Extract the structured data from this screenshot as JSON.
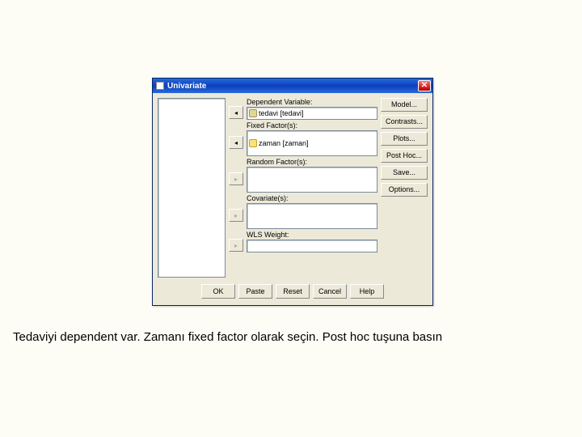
{
  "window": {
    "title": "Univariate"
  },
  "fields": {
    "dependent": {
      "label": "Dependent Variable:",
      "value": "tedavi [tedavi]"
    },
    "fixed": {
      "label": "Fixed Factor(s):",
      "value": "zaman [zaman]"
    },
    "random": {
      "label": "Random Factor(s):",
      "value": ""
    },
    "covariate": {
      "label": "Covariate(s):",
      "value": ""
    },
    "wls": {
      "label": "WLS Weight:",
      "value": ""
    }
  },
  "arrows": {
    "left": "◂",
    "right": "▸"
  },
  "sideButtons": {
    "model": "Model...",
    "contrasts": "Contrasts...",
    "plots": "Plots...",
    "posthoc": "Post Hoc...",
    "save": "Save...",
    "options": "Options..."
  },
  "bottomButtons": {
    "ok": "OK",
    "paste": "Paste",
    "reset": "Reset",
    "cancel": "Cancel",
    "help": "Help"
  },
  "caption": "Tedaviyi dependent var. Zamanı fixed factor olarak seçin. Post hoc tuşuna basın"
}
